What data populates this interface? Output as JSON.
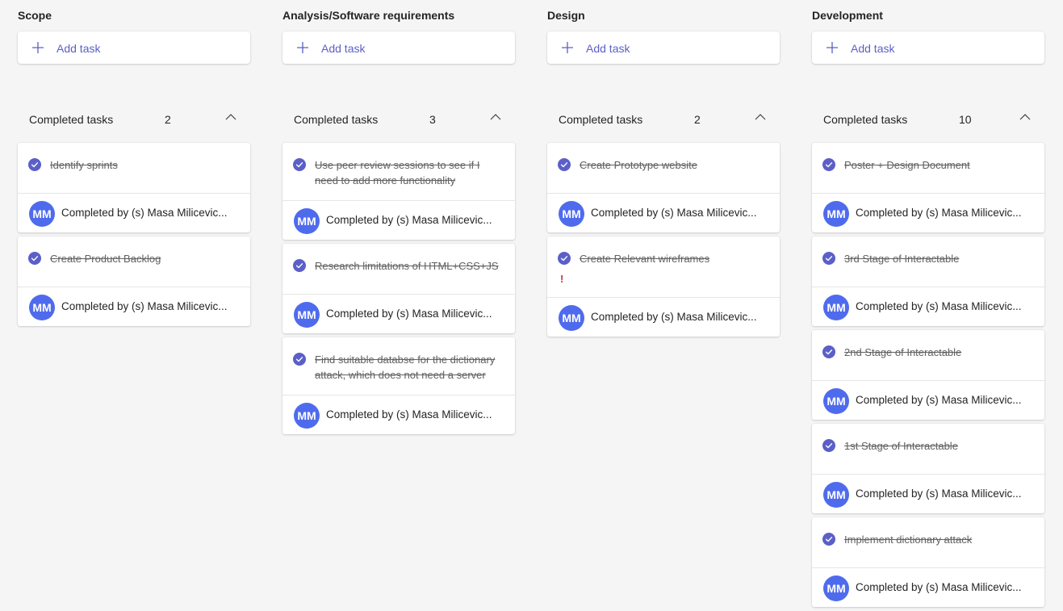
{
  "colors": {
    "accent": "#5b5fc7",
    "avatar": "#4f6bed",
    "priority": "#c4314b"
  },
  "columns": [
    {
      "title": "Scope",
      "add_task": "Add task",
      "completed_label": "Completed tasks",
      "completed_count": "2",
      "tasks": [
        {
          "title": "Identify sprints",
          "avatar": "MM",
          "completed_by": "Completed by (s) Masa Milicevic..."
        },
        {
          "title": "Create Product Backlog",
          "avatar": "MM",
          "completed_by": "Completed by (s) Masa Milicevic..."
        }
      ]
    },
    {
      "title": "Analysis/Software requirements",
      "add_task": "Add task",
      "completed_label": "Completed tasks",
      "completed_count": "3",
      "tasks": [
        {
          "title": "Use peer review sessions to see if I need to add more functionality",
          "avatar": "MM",
          "completed_by": "Completed by (s) Masa Milicevic..."
        },
        {
          "title": "Research limitations of HTML+CSS+JS",
          "avatar": "MM",
          "completed_by": "Completed by (s) Masa Milicevic..."
        },
        {
          "title": "Find suitable databse for the dictionary attack, which does not need a server",
          "avatar": "MM",
          "completed_by": "Completed by (s) Masa Milicevic..."
        }
      ]
    },
    {
      "title": "Design",
      "add_task": "Add task",
      "completed_label": "Completed tasks",
      "completed_count": "2",
      "tasks": [
        {
          "title": "Create Prototype website",
          "avatar": "MM",
          "completed_by": "Completed by (s) Masa Milicevic..."
        },
        {
          "title": "Create Relevant wireframes",
          "priority": "!",
          "avatar": "MM",
          "completed_by": "Completed by (s) Masa Milicevic..."
        }
      ]
    },
    {
      "title": "Development",
      "add_task": "Add task",
      "completed_label": "Completed tasks",
      "completed_count": "10",
      "tasks": [
        {
          "title": "Poster + Design Document",
          "avatar": "MM",
          "completed_by": "Completed by (s) Masa Milicevic..."
        },
        {
          "title": "3rd Stage of Interactable",
          "avatar": "MM",
          "completed_by": "Completed by (s) Masa Milicevic..."
        },
        {
          "title": "2nd Stage of Interactable",
          "avatar": "MM",
          "completed_by": "Completed by (s) Masa Milicevic..."
        },
        {
          "title": "1st Stage of Interactable",
          "avatar": "MM",
          "completed_by": "Completed by (s) Masa Milicevic..."
        },
        {
          "title": "Implement dictionary attack",
          "avatar": "MM",
          "completed_by": "Completed by (s) Masa Milicevic..."
        }
      ]
    }
  ]
}
